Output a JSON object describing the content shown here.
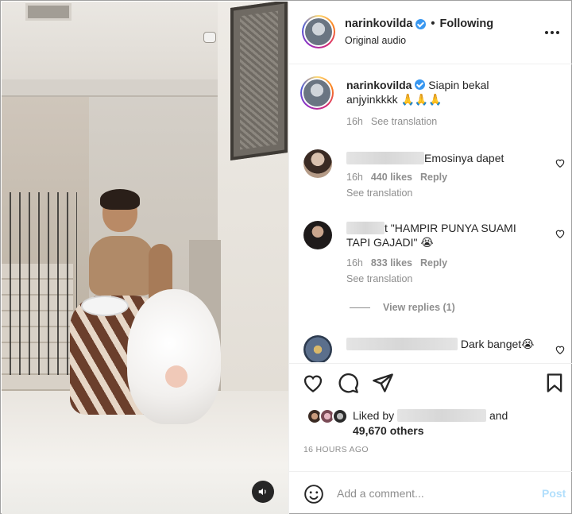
{
  "header": {
    "username": "narinkovilda",
    "separator": "•",
    "follow_status": "Following",
    "audio": "Original audio"
  },
  "caption": {
    "username": "narinkovilda",
    "text": "Siapin bekal anjyinkkkk 🙏🙏🙏",
    "time": "16h",
    "see_translation": "See translation"
  },
  "comments": [
    {
      "text": "Emosinya dapet",
      "time": "16h",
      "likes": "440 likes",
      "reply": "Reply",
      "see_translation": "See translation"
    },
    {
      "text": "t \"HAMPIR PUNYA SUAMI TAPI GAJADI\" 😭",
      "time": "16h",
      "likes": "833 likes",
      "reply": "Reply",
      "see_translation": "See translation",
      "view_replies": "View replies (1)"
    },
    {
      "text": "Dark banget😭"
    }
  ],
  "likes": {
    "prefix": "Liked by",
    "and": "and",
    "others": "49,670 others"
  },
  "timestamp": "16 HOURS AGO",
  "add_comment": {
    "placeholder": "Add a comment...",
    "post": "Post"
  },
  "colors": {
    "verified": "#3897f0",
    "post_disabled": "#b2dffc",
    "muted_text": "#8e8e8e"
  },
  "icons": [
    "verified-icon",
    "more-icon",
    "heart-icon",
    "comment-icon",
    "share-icon",
    "bookmark-icon",
    "emoji-icon",
    "sound-icon"
  ]
}
